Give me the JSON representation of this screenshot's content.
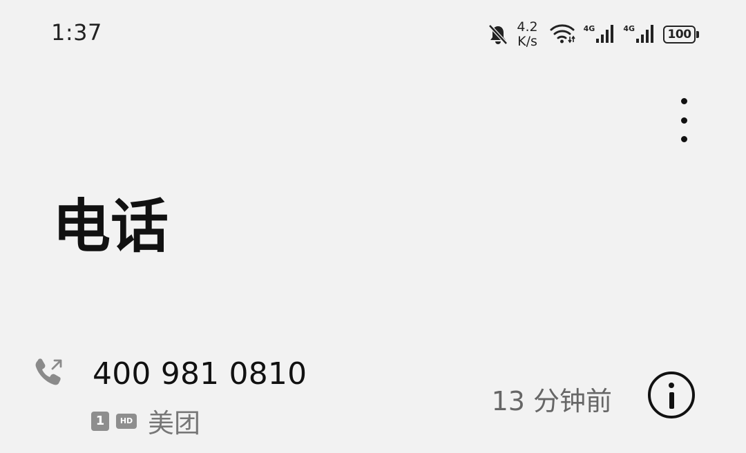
{
  "status_bar": {
    "time": "1:37",
    "net_speed_value": "4.2",
    "net_speed_unit": "K/s",
    "sim1_network": "4G",
    "sim2_network": "4G",
    "battery": "100",
    "icons": [
      "bell-muted-icon",
      "wifi-icon",
      "signal-icon",
      "signal-icon",
      "battery-icon"
    ]
  },
  "header": {
    "title": "电话",
    "more_icon": "more-vertical-icon"
  },
  "call_log": [
    {
      "icon": "outgoing-call-icon",
      "number": "400 981 0810",
      "sim": "1",
      "hd": "HD",
      "label": "美团",
      "time": "13 分钟前",
      "info_icon": "info-icon"
    }
  ],
  "colors": {
    "background": "#f2f2f2",
    "text_primary": "#111111",
    "text_secondary": "#777777",
    "badge": "#8e8e8e"
  }
}
